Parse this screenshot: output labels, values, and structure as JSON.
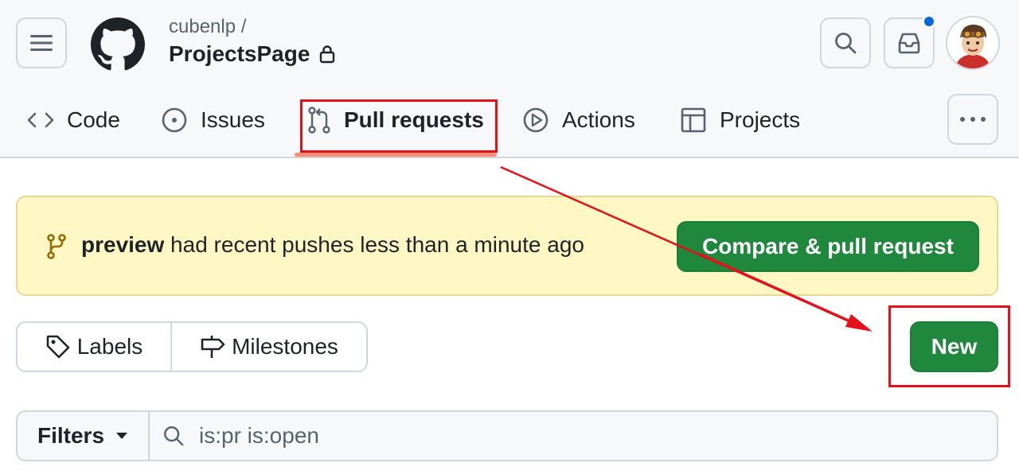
{
  "header": {
    "owner": "cubenlp /",
    "repo_name": "ProjectsPage",
    "visibility_icon": "lock-icon",
    "has_unread_notifications": true
  },
  "tabs": [
    {
      "label": "Code",
      "icon": "code-icon"
    },
    {
      "label": "Issues",
      "icon": "issue-opened-icon"
    },
    {
      "label": "Pull requests",
      "icon": "git-pull-request-icon",
      "selected": true
    },
    {
      "label": "Actions",
      "icon": "play-icon"
    },
    {
      "label": "Projects",
      "icon": "table-icon"
    }
  ],
  "banner": {
    "branch": "preview",
    "message": " had recent pushes less than a minute ago",
    "button_label": "Compare & pull request"
  },
  "toolbar": {
    "labels_label": "Labels",
    "milestones_label": "Milestones",
    "new_label": "New"
  },
  "filter": {
    "filters_label": "Filters",
    "query": "is:pr is:open"
  },
  "colors": {
    "primary_green": "#1f883d",
    "banner_bg": "#fff8c5",
    "accent_underline": "#fd8c73",
    "annotation_red": "#e5111a",
    "notification_blue": "#0969da"
  }
}
